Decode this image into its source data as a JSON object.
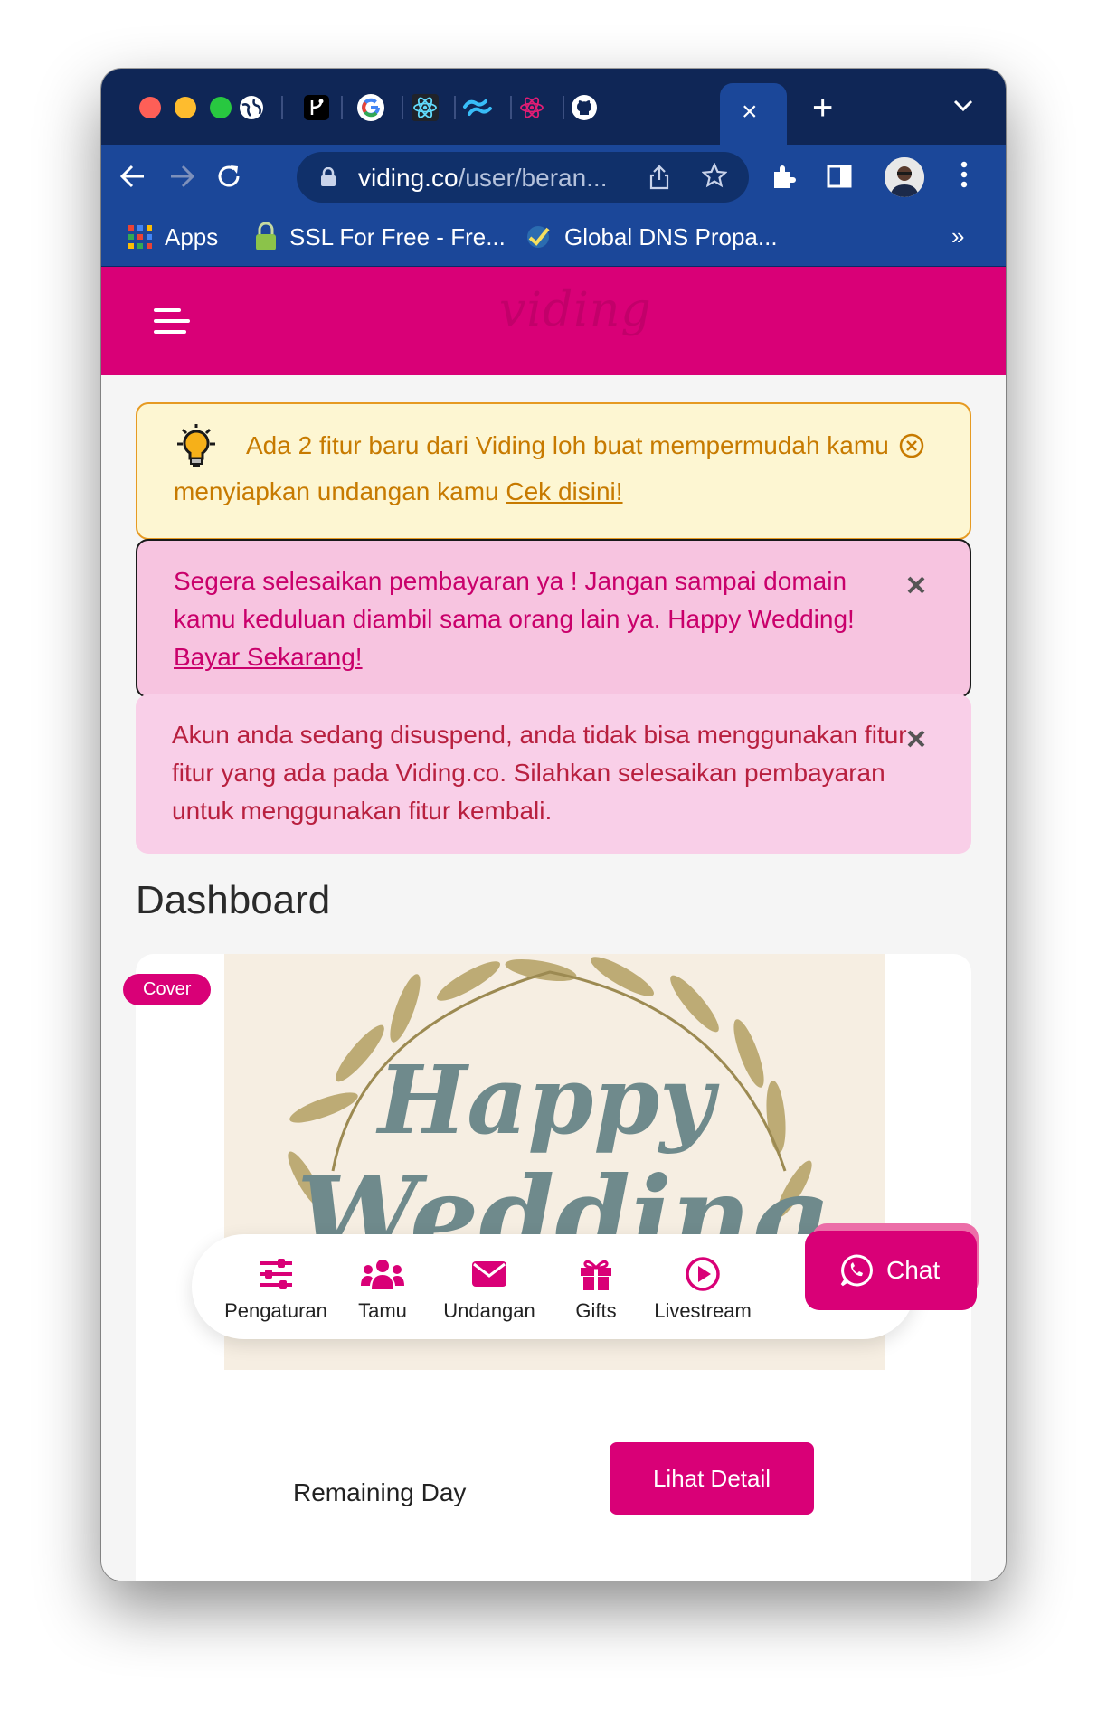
{
  "browser": {
    "active_tab_close": "×",
    "new_tab": "+",
    "url_host": "viding.co",
    "url_path": "/user/beran...",
    "bookmarks": [
      {
        "label": "Apps",
        "icon": "apps-grid-icon"
      },
      {
        "label": "SSL For Free - Fre...",
        "icon": "lock-icon"
      },
      {
        "label": "Global DNS Propa...",
        "icon": "dns-globe-icon"
      }
    ],
    "bookmarks_more": "»",
    "colors": {
      "tabstrip": "#0f2656",
      "toolbar": "#1b4799"
    }
  },
  "app": {
    "logo": "viding",
    "accent": "#d90077"
  },
  "alerts": {
    "info": {
      "text": "Ada 2 fitur baru dari Viding loh buat mempermudah kamu menyiapkan undangan kamu ",
      "link": "Cek disini!"
    },
    "payment": {
      "text": "Segera selesaikan pembayaran ya ! Jangan sampai domain kamu keduluan diambil sama orang lain ya. Happy Wedding! ",
      "link": "Bayar Sekarang!"
    },
    "suspend": {
      "text": "Akun anda sedang disuspend, anda tidak bisa menggunakan fitur - fitur yang ada pada Viding.co. Silahkan selesaikan pembayaran untuk menggunakan fitur kembali."
    }
  },
  "dashboard": {
    "title": "Dashboard",
    "cover_badge": "Cover",
    "cover_text_line1": "Happy",
    "cover_text_line2": "Wedding",
    "remaining_label": "Remaining Day",
    "detail_button": "Lihat Detail"
  },
  "chat": {
    "label": "Chat"
  },
  "bottom_nav": [
    {
      "label": "Pengaturan",
      "icon": "sliders-icon"
    },
    {
      "label": "Tamu",
      "icon": "users-icon"
    },
    {
      "label": "Undangan",
      "icon": "envelope-icon"
    },
    {
      "label": "Gifts",
      "icon": "gift-icon"
    },
    {
      "label": "Livestream",
      "icon": "play-circle-icon"
    }
  ]
}
